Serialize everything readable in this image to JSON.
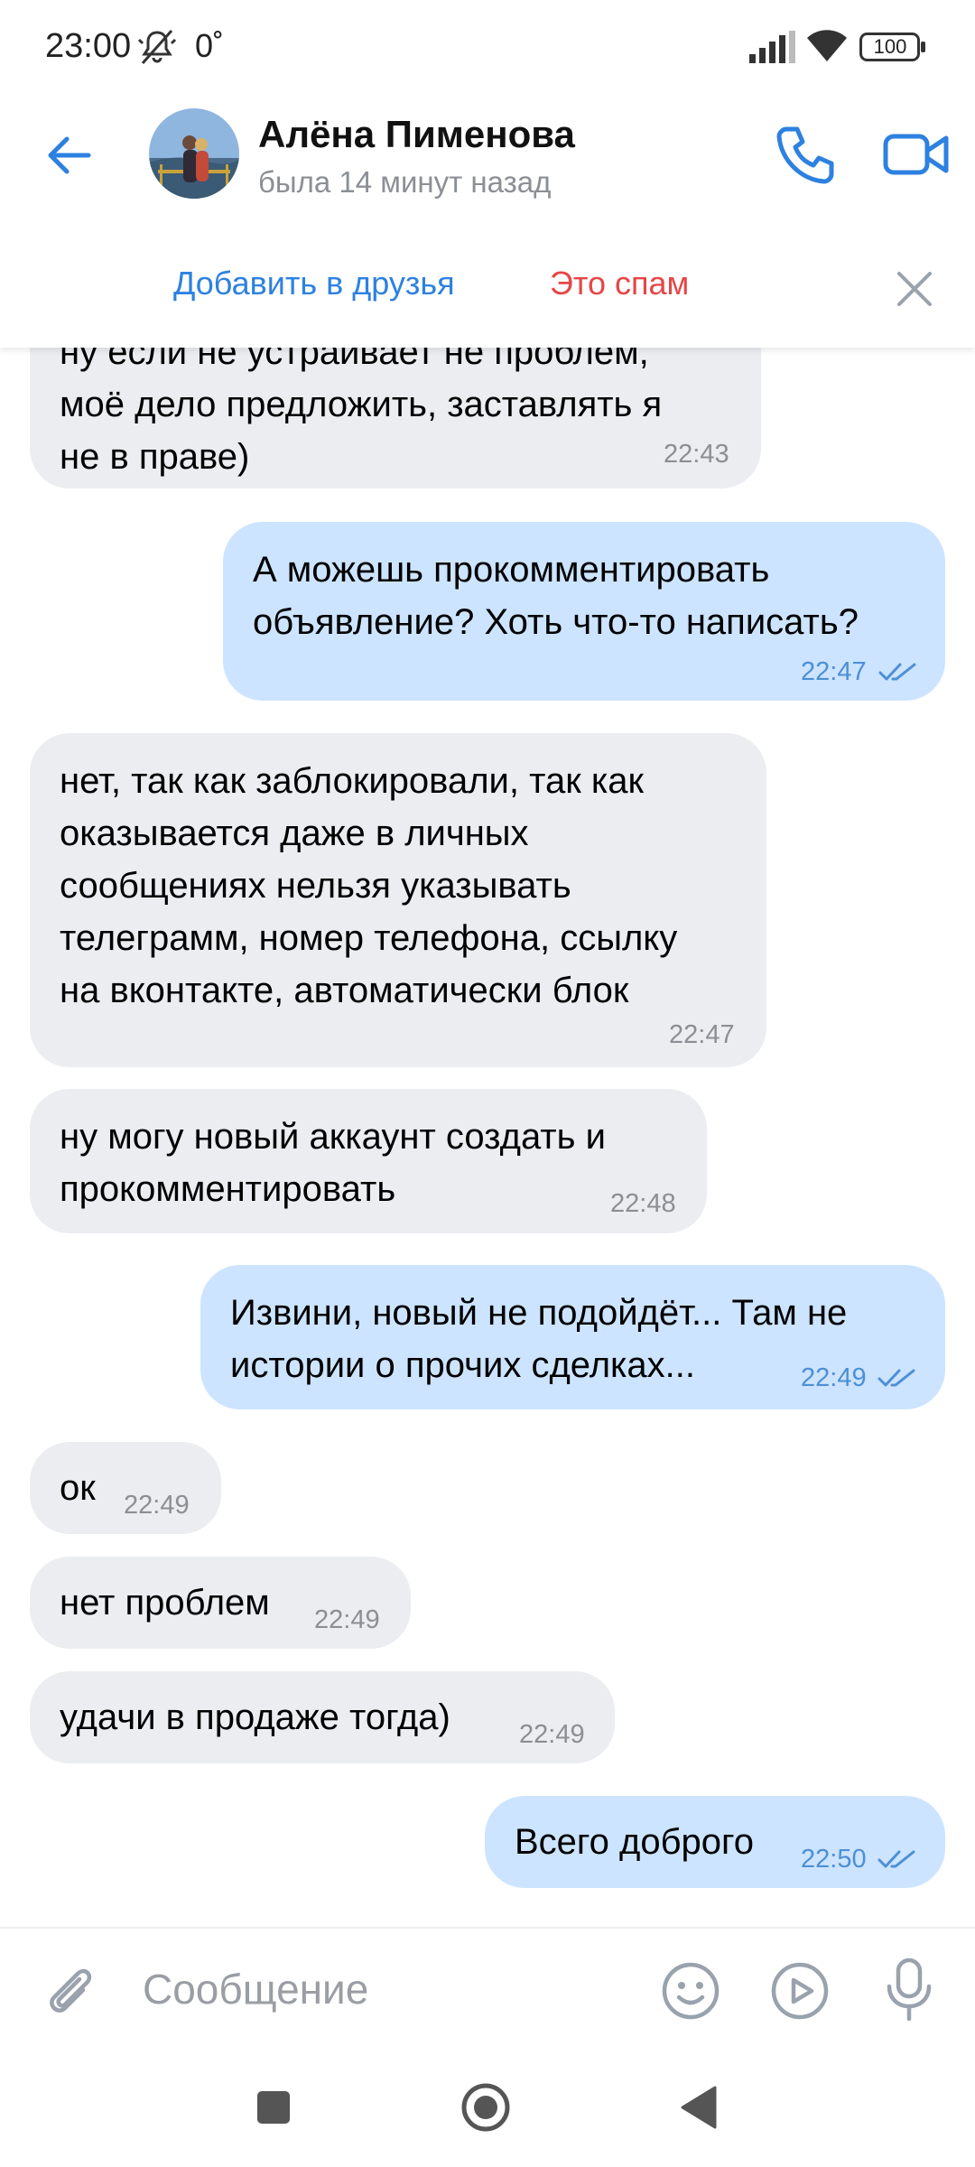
{
  "status_bar": {
    "time": "23:00",
    "temperature": "0˚",
    "battery": "100",
    "icons": [
      "mute-icon",
      "signal-icon",
      "wifi-icon",
      "battery-icon"
    ]
  },
  "header": {
    "contact_name": "Алёна Пименова",
    "contact_status": "была 14 минут назад",
    "icons": [
      "back-arrow-icon",
      "phone-icon",
      "video-camera-icon"
    ]
  },
  "action_bar": {
    "add_friend": "Добавить в друзья",
    "spam": "Это спам",
    "icons": [
      "close-icon"
    ]
  },
  "messages": [
    {
      "direction": "in",
      "lines": [
        "ну если не устраивает не проблем,",
        "моё дело предложить, заставлять я",
        "не в праве)"
      ],
      "time": "22:43"
    },
    {
      "direction": "out",
      "lines": [
        "А можешь прокомментировать",
        "объявление? Хоть что-то написать?"
      ],
      "time": "22:47",
      "read": true
    },
    {
      "direction": "in",
      "lines": [
        "нет, так как заблокировали, так как",
        "оказывается даже в личных",
        "сообщениях нельзя указывать",
        "телеграмм, номер телефона, ссылку",
        "на вконтакте, автоматически блок"
      ],
      "time": "22:47"
    },
    {
      "direction": "in",
      "lines": [
        "ну могу новый аккаунт создать и",
        "прокомментировать"
      ],
      "time": "22:48"
    },
    {
      "direction": "out",
      "lines": [
        "Извини, новый не подойдёт... Там не",
        "истории о прочих сделках..."
      ],
      "time": "22:49",
      "read": true
    },
    {
      "direction": "in",
      "lines": [
        "ок"
      ],
      "time": "22:49"
    },
    {
      "direction": "in",
      "lines": [
        "нет проблем"
      ],
      "time": "22:49"
    },
    {
      "direction": "in",
      "lines": [
        "удачи в продаже тогда)"
      ],
      "time": "22:49"
    },
    {
      "direction": "out",
      "lines": [
        "Всего доброго"
      ],
      "time": "22:50",
      "read": true
    }
  ],
  "composer": {
    "placeholder": "Сообщение",
    "icons": [
      "paperclip-icon",
      "emoji-icon",
      "video-message-icon",
      "microphone-icon"
    ]
  },
  "nav_bar": {
    "icons": [
      "recents-square-icon",
      "home-circle-icon",
      "back-triangle-icon"
    ]
  },
  "colors": {
    "accent": "#2d81e0",
    "spam": "#e64646",
    "incoming_bubble": "#ebedf0",
    "outgoing_bubble": "#cce4ff"
  }
}
